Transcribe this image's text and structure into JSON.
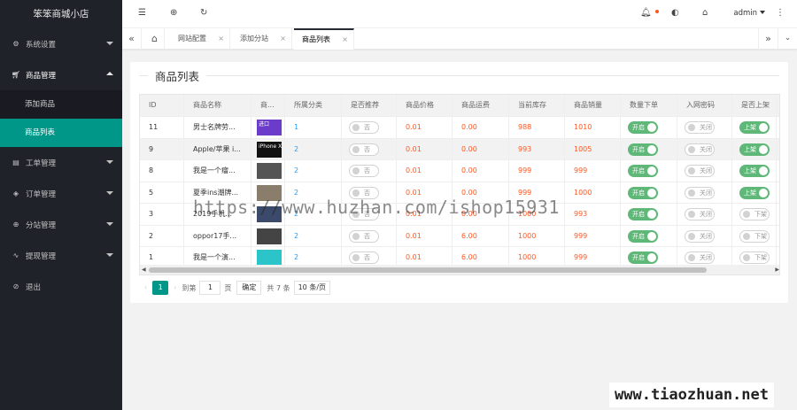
{
  "app": {
    "title": "笨笨商城小店"
  },
  "sidebar": {
    "items": [
      {
        "label": "系统设置",
        "icon": "gear-icon"
      },
      {
        "label": "商品管理",
        "icon": "cart-icon"
      },
      {
        "label": "工单管理",
        "icon": "ticket-icon"
      },
      {
        "label": "订单管理",
        "icon": "box-icon"
      },
      {
        "label": "分站管理",
        "icon": "globe-icon"
      },
      {
        "label": "提现管理",
        "icon": "pulse-icon"
      },
      {
        "label": "退出",
        "icon": "logout-icon"
      }
    ],
    "subitems": [
      {
        "label": "添加商品"
      },
      {
        "label": "商品列表"
      }
    ]
  },
  "header": {
    "user": "admin"
  },
  "tabs": [
    {
      "label": "网站配置"
    },
    {
      "label": "添加分站"
    },
    {
      "label": "商品列表"
    }
  ],
  "page": {
    "title": "商品列表"
  },
  "table": {
    "columns": [
      "ID",
      "商品名称",
      "商...",
      "所属分类",
      "是否推荐",
      "商品价格",
      "商品运费",
      "当前库存",
      "商品销量",
      "数量下单",
      "入网密码",
      "是否上架"
    ],
    "rows": [
      {
        "id": "11",
        "name": "男士名牌劳...",
        "cat": "1",
        "rec": "否",
        "price": "0.01",
        "ship": "0.00",
        "stock": "988",
        "sales": "1010",
        "qty": "开启",
        "pwd": "关闭",
        "shelf": "上架"
      },
      {
        "id": "9",
        "name": "Apple/苹果 i...",
        "cat": "2",
        "rec": "否",
        "price": "0.01",
        "ship": "0.00",
        "stock": "993",
        "sales": "1005",
        "qty": "开启",
        "pwd": "关闭",
        "shelf": "上架"
      },
      {
        "id": "8",
        "name": "我是一个瘤...",
        "cat": "2",
        "rec": "否",
        "price": "0.01",
        "ship": "0.00",
        "stock": "999",
        "sales": "999",
        "qty": "开启",
        "pwd": "关闭",
        "shelf": "上架"
      },
      {
        "id": "5",
        "name": "夏季ins潮牌...",
        "cat": "2",
        "rec": "否",
        "price": "0.01",
        "ship": "0.00",
        "stock": "999",
        "sales": "1000",
        "qty": "开启",
        "pwd": "关闭",
        "shelf": "上架"
      },
      {
        "id": "3",
        "name": "2019手机...",
        "cat": "2",
        "rec": "否",
        "price": "0.01",
        "ship": "0.00",
        "stock": "1000",
        "sales": "993",
        "qty": "开启",
        "pwd": "关闭",
        "shelf": "下架"
      },
      {
        "id": "2",
        "name": "oppor17手...",
        "cat": "2",
        "rec": "否",
        "price": "0.01",
        "ship": "6.00",
        "stock": "1000",
        "sales": "999",
        "qty": "开启",
        "pwd": "关闭",
        "shelf": "下架"
      },
      {
        "id": "1",
        "name": "我是一个演...",
        "cat": "2",
        "rec": "否",
        "price": "0.01",
        "ship": "6.00",
        "stock": "1000",
        "sales": "999",
        "qty": "开启",
        "pwd": "关闭",
        "shelf": "下架"
      }
    ]
  },
  "pager": {
    "current": "1",
    "goto_label": "到第",
    "page_input": "1",
    "page_label": "页",
    "ok_label": "确定",
    "total": "共 7 条",
    "per_page": "10 条/页"
  },
  "thumbs": [
    {
      "text": "进口",
      "color": "#6a3cc9"
    },
    {
      "text": "iPhone X",
      "color": "#111111"
    },
    {
      "text": "",
      "color": "#555555"
    },
    {
      "text": "",
      "color": "#8b7d6b"
    },
    {
      "text": "",
      "color": "#3b4a6b"
    },
    {
      "text": "",
      "color": "#444444"
    },
    {
      "text": "",
      "color": "#2bc5c9"
    }
  ],
  "watermarks": [
    "https://www.huzhan.com/ishop15931",
    "www.tiaozhuan.net"
  ]
}
